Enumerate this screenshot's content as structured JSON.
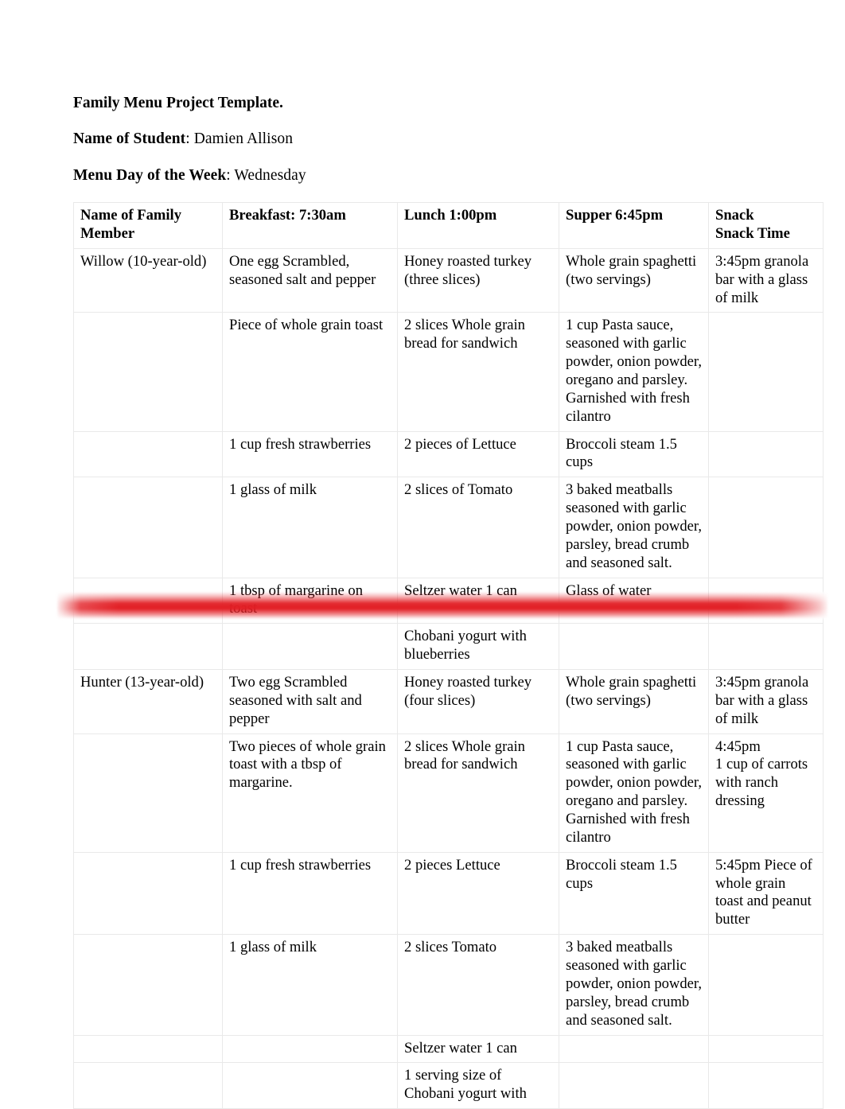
{
  "document": {
    "title": "Family Menu Project Template.",
    "student_label": "Name of Student",
    "student_name": ": Damien Allison",
    "day_label": "Menu Day of the Week",
    "day_value": ": Wednesday"
  },
  "highlight": {
    "color": "#e21e24",
    "name": "red-highlight-band"
  },
  "table": {
    "headers": {
      "member": "Name of Family Member",
      "member_line1": "Name of Family",
      "member_line2": "Member",
      "breakfast": "Breakfast: 7:30am",
      "lunch": "Lunch 1:00pm",
      "supper": "Supper 6:45pm",
      "snack_line1": "Snack",
      "snack_line2": "Snack Time"
    },
    "members": [
      {
        "name": "Willow (10-year-old)",
        "rows": [
          {
            "breakfast": "One egg Scrambled, seasoned salt and pepper",
            "lunch": "Honey roasted turkey (three slices)",
            "supper": "Whole grain spaghetti (two servings)",
            "snack": "3:45pm granola bar with a glass of milk"
          },
          {
            "breakfast": "Piece of whole grain toast",
            "lunch": "2 slices Whole grain bread for sandwich",
            "supper": "1 cup Pasta sauce, seasoned with garlic powder, onion powder, oregano and parsley. Garnished with fresh cilantro",
            "snack": ""
          },
          {
            "breakfast": "1 cup fresh strawberries",
            "lunch": "2 pieces of Lettuce",
            "supper": "Broccoli steam 1.5 cups",
            "snack": ""
          },
          {
            "breakfast": "1 glass of milk",
            "lunch": "2 slices of Tomato",
            "supper": "3 baked meatballs seasoned with garlic powder, onion powder, parsley, bread crumb and seasoned salt.",
            "snack": ""
          },
          {
            "breakfast": "1 tbsp of margarine on toast",
            "lunch": "Seltzer water 1 can",
            "supper": "Glass of water",
            "snack": ""
          },
          {
            "breakfast": "",
            "lunch": "Chobani yogurt with blueberries",
            "supper": "",
            "snack": ""
          }
        ]
      },
      {
        "name": "Hunter (13-year-old)",
        "rows": [
          {
            "breakfast": "Two egg Scrambled seasoned with salt and pepper",
            "lunch": "Honey roasted turkey (four slices)",
            "supper": "Whole grain spaghetti (two servings)",
            "snack": "3:45pm granola bar with a glass of milk"
          },
          {
            "breakfast": "Two pieces of whole grain toast with a tbsp of margarine.",
            "lunch": "2 slices Whole grain bread for sandwich",
            "supper": "1 cup Pasta sauce, seasoned with garlic powder, onion powder, oregano and parsley. Garnished with fresh cilantro",
            "snack": "4:45pm\n1 cup of carrots with ranch dressing"
          },
          {
            "breakfast": "1 cup fresh strawberries",
            "lunch": "2 pieces Lettuce",
            "supper": "Broccoli steam 1.5 cups",
            "snack": "5:45pm Piece of whole grain toast and peanut butter"
          },
          {
            "breakfast": "1 glass of milk",
            "lunch": "2 slices Tomato",
            "supper": "3 baked meatballs seasoned with garlic powder, onion powder, parsley, bread crumb and seasoned salt.",
            "snack": ""
          },
          {
            "breakfast": "",
            "lunch": "Seltzer water 1 can",
            "supper": "",
            "snack": ""
          },
          {
            "breakfast": "",
            "lunch": "1 serving size of Chobani yogurt with",
            "supper": "",
            "snack": ""
          }
        ]
      }
    ]
  }
}
